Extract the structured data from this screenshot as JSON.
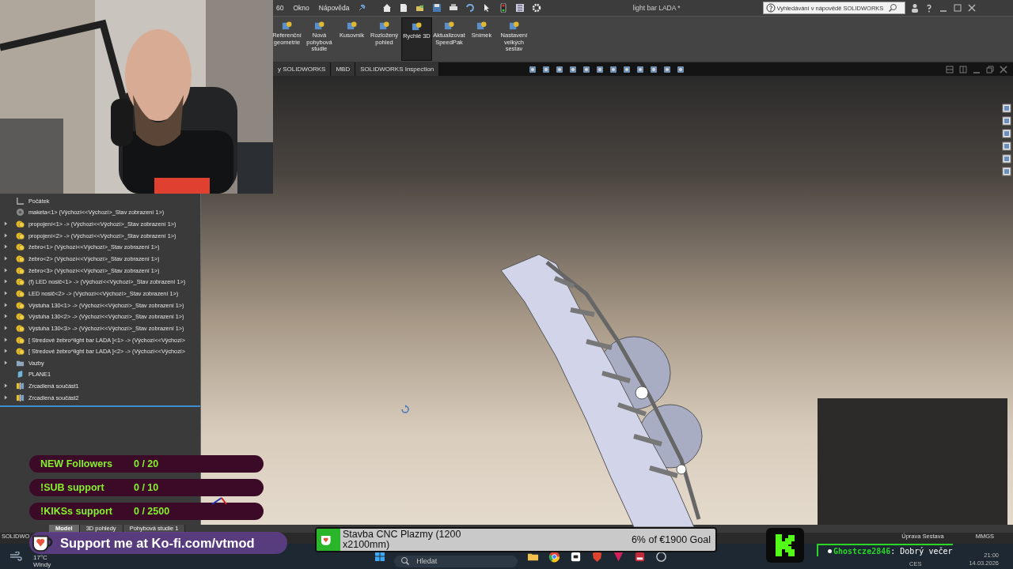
{
  "menu_bar": {
    "items": [
      "60",
      "Okno",
      "Nápověda"
    ],
    "title": "light bar LADA *",
    "help_search": {
      "placeholder": "Vyhledávání v nápovědě SOLIDWORKS"
    }
  },
  "ribbon": {
    "buttons": [
      {
        "label": "Referenční geometrie",
        "selected": false
      },
      {
        "label": "Nová pohybová studie",
        "selected": false
      },
      {
        "label": "Kusovník",
        "selected": false
      },
      {
        "label": "Rozložený pohled",
        "selected": false
      },
      {
        "label": "Rychlé 3D",
        "selected": true
      },
      {
        "label": "Aktualizovat SpeedPak",
        "selected": false
      },
      {
        "label": "Snímek",
        "selected": false
      },
      {
        "label": "Nastavení velkých sestav",
        "selected": false
      }
    ],
    "tabs": [
      {
        "label": "y SOLIDWORKS",
        "selected": false
      },
      {
        "label": "MBD",
        "selected": false
      },
      {
        "label": "SOLIDWORKS Inspection",
        "selected": false
      }
    ]
  },
  "feature_tree": {
    "items": [
      {
        "label": "Počátek",
        "kind": "origin",
        "expandable": false
      },
      {
        "label": "maketa<1> (Výchozí<<Výchozí>_Stav zobrazení 1>)",
        "kind": "part",
        "expandable": false
      },
      {
        "label": "propojení<1> -> (Výchozí<<Výchozí>_Stav zobrazení 1>)",
        "kind": "assembly",
        "expandable": true
      },
      {
        "label": "propojení<2> -> (Výchozí<<Výchozí>_Stav zobrazení 1>)",
        "kind": "assembly",
        "expandable": true
      },
      {
        "label": "žebro<1> (Výchozí<<Výchozí>_Stav zobrazení 1>)",
        "kind": "assembly",
        "expandable": true
      },
      {
        "label": "žebro<2> (Výchozí<<Výchozí>_Stav zobrazení 1>)",
        "kind": "assembly",
        "expandable": true
      },
      {
        "label": "žebro<3> (Výchozí<<Výchozí>_Stav zobrazení 1>)",
        "kind": "assembly",
        "expandable": true
      },
      {
        "label": "(f) LED nosič<1> -> (Výchozí<<Výchozí>_Stav zobrazení 1>)",
        "kind": "assembly",
        "expandable": true
      },
      {
        "label": "LED nosič<2> -> (Výchozí<<Výchozí>_Stav zobrazení 1>)",
        "kind": "assembly",
        "expandable": true
      },
      {
        "label": "Výstuha 130<1> -> (Výchozí<<Výchozí>_Stav zobrazení 1>)",
        "kind": "assembly",
        "expandable": true
      },
      {
        "label": "Výstuha 130<2> -> (Výchozí<<Výchozí>_Stav zobrazení 1>)",
        "kind": "assembly",
        "expandable": true
      },
      {
        "label": "Výstuha 130<3> -> (Výchozí<<Výchozí>_Stav zobrazení 1>)",
        "kind": "assembly",
        "expandable": true
      },
      {
        "label": "[ Stredové žebro^light bar LADA ]<1> -> (Výchozí<<Výchozí>",
        "kind": "assembly",
        "expandable": true
      },
      {
        "label": "[ Stredové žebro^light bar LADA ]<2> -> (Výchozí<<Výchozí>",
        "kind": "assembly",
        "expandable": true
      },
      {
        "label": "Vazby",
        "kind": "folder",
        "expandable": true
      },
      {
        "label": "PLANE1",
        "kind": "plane",
        "expandable": false
      },
      {
        "label": "Zrcadlená součást1",
        "kind": "mirror",
        "expandable": true
      },
      {
        "label": "Zrcadlená součást2",
        "kind": "mirror",
        "expandable": true
      }
    ]
  },
  "model_tabs": [
    {
      "label": "Model",
      "selected": true
    },
    {
      "label": "3D pohledy",
      "selected": false
    },
    {
      "label": "Pohybová studie 1",
      "selected": false
    }
  ],
  "status_bar": {
    "app": "SOLIDWO",
    "items": [
      "Úprava Sestava",
      "MMGS"
    ]
  },
  "taskbar": {
    "temperature": "17°C",
    "weather": "Windy",
    "search": {
      "placeholder": "Hledat"
    },
    "language": "CES",
    "time": "21:00",
    "date": "14.03.2026"
  },
  "overlays": {
    "goals": [
      {
        "label": "NEW Followers",
        "count": "0 / 20"
      },
      {
        "label": "!SUB support",
        "count": "0 / 10"
      },
      {
        "label": "!KIKSs support",
        "count": "0 / 2500"
      }
    ],
    "kofi": "Support me at Ko-fi.com/vtmod",
    "donation": {
      "title": "Stavba CNC Plazmy (1200 x2100mm)",
      "goal": "6% of €1900 Goal",
      "level": 0.06
    },
    "chat": {
      "user": "Ghostcze2846",
      "separator": ":",
      "message": "Dobrý večer"
    }
  }
}
